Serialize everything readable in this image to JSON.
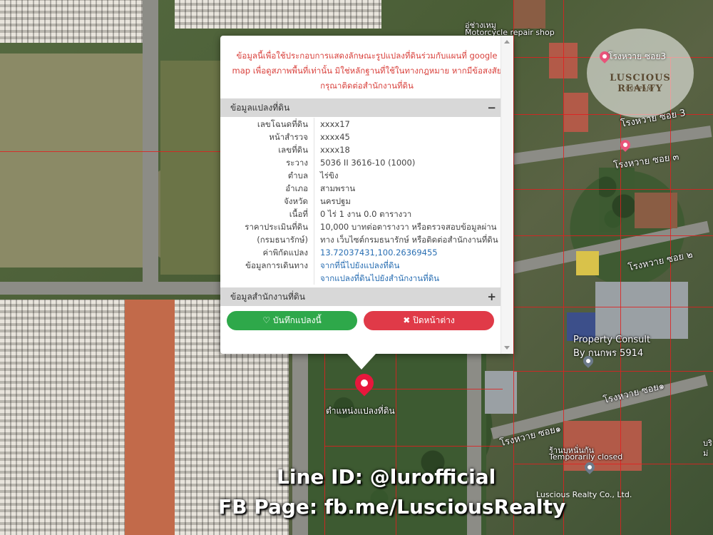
{
  "popup": {
    "close_label": "×",
    "notice": "ข้อมูลนี้เพื่อใช้ประกอบการแสดงลักษณะรูปแปลงที่ดินร่วมกับแผนที่ google map เพื่อดูสภาพพื้นที่เท่านั้น มิใช่หลักฐานที่ใช้ในทางกฎหมาย หากมีข้อสงสัย กรุณาติดต่อสำนักงานที่ดิน",
    "section1": {
      "title": "ข้อมูลแปลงที่ดิน",
      "toggle": "−"
    },
    "rows": [
      {
        "key": "เลขโฉนดที่ดิน",
        "value": "xxxx17"
      },
      {
        "key": "หน้าสำรวจ",
        "value": "xxxx45"
      },
      {
        "key": "เลขที่ดิน",
        "value": "xxxx18"
      },
      {
        "key": "ระวาง",
        "value": "5036 II 3616-10 (1000)"
      },
      {
        "key": "ตำบล",
        "value": "ไร่ขิง"
      },
      {
        "key": "อำเภอ",
        "value": "สามพราน"
      },
      {
        "key": "จังหวัด",
        "value": "นครปฐม"
      },
      {
        "key": "เนื้อที่",
        "value": "0 ไร่ 1 งาน 0.0 ตารางวา"
      },
      {
        "key": "ราคาประเมินที่ดิน",
        "value": "10,000 บาทต่อตารางวา หรือตรวจสอบข้อมูลผ่าน"
      },
      {
        "key": "(กรมธนารักษ์)",
        "value": "ทาง เว็บไซต์กรมธนารักษ์ หรือติดต่อสำนักงานที่ดิน"
      },
      {
        "key": "ค่าพิกัดแปลง",
        "value": "13.72037431,100.26369455"
      },
      {
        "key": "ข้อมูลการเดินทาง",
        "value": "จากที่นี่ไปยังแปลงที่ดิน"
      },
      {
        "key": "",
        "value": "จากแปลงที่ดินไปยังสำนักงานที่ดิน"
      }
    ],
    "section2": {
      "title": "ข้อมูลสำนักงานที่ดิน",
      "toggle": "+"
    },
    "save_button": "♡ บันทึกแปลงนี้",
    "close_button": "✖ ปิดหน้าต่าง"
  },
  "map": {
    "parcel_label": "ตำแหน่งแปลงที่ดิน",
    "labels": [
      {
        "text": "อู่ช่างเหมู",
        "cls": "small"
      },
      {
        "text": "Motorcycle repair shop",
        "cls": "small"
      },
      {
        "text": "โรงหวาย ซอย 3",
        "cls": ""
      },
      {
        "text": "โรงหวาย ซอย ๓",
        "cls": ""
      },
      {
        "text": "โรงหวาย ซอย ๒",
        "cls": ""
      },
      {
        "text": "Property Consult",
        "cls": ""
      },
      {
        "text": "By กนกพร 5914",
        "cls": ""
      },
      {
        "text": "โรงหวาย ซอย๑",
        "cls": ""
      },
      {
        "text": "โรงหวาย ซอย๑",
        "cls": ""
      },
      {
        "text": "ร้านบุหนั่นกัน",
        "cls": "small"
      },
      {
        "text": "Temporarily closed",
        "cls": "small"
      },
      {
        "text": "บริ",
        "cls": "small"
      },
      {
        "text": "ม่",
        "cls": "small"
      }
    ]
  },
  "logo": {
    "pin_label": "โรงหวาย ซอย3",
    "name": "LUSCIOUS REALTY",
    "sub": "COMPANY"
  },
  "watermark": {
    "line_id": "Line ID: @lurofficial",
    "fb_page": "FB Page: fb.me/LusciousRealty",
    "company": "Luscious Realty Co., Ltd."
  }
}
